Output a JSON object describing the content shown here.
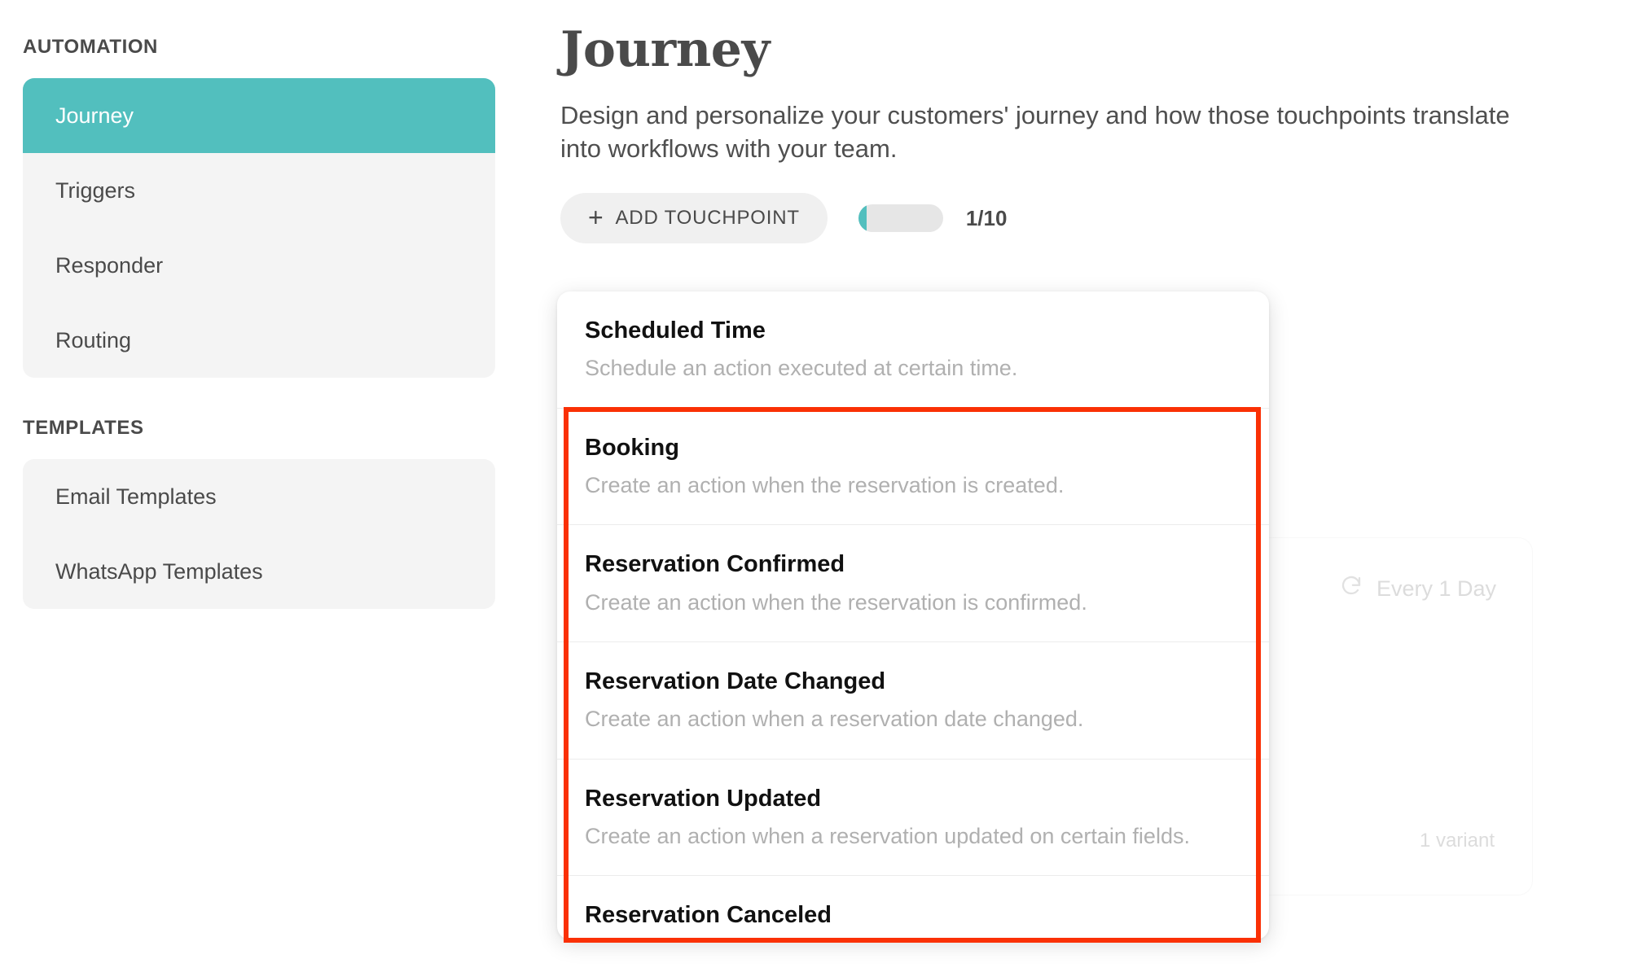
{
  "sidebar": {
    "sections": [
      {
        "label": "AUTOMATION",
        "items": [
          {
            "label": "Journey",
            "active": true
          },
          {
            "label": "Triggers",
            "active": false
          },
          {
            "label": "Responder",
            "active": false
          },
          {
            "label": "Routing",
            "active": false
          }
        ]
      },
      {
        "label": "TEMPLATES",
        "items": [
          {
            "label": "Email Templates",
            "active": false
          },
          {
            "label": "WhatsApp Templates",
            "active": false
          }
        ]
      }
    ]
  },
  "main": {
    "title": "Journey",
    "subtitle": "Design and personalize your customers' journey and how those touchpoints translate into workflows with your team.",
    "toolbar": {
      "add_touchpoint_label": "ADD TOUCHPOINT",
      "add_icon": "plus-icon",
      "progress_count": "1/10",
      "progress_current": 1,
      "progress_total": 10,
      "progress_percent": 10
    }
  },
  "background_card": {
    "schedule_icon": "refresh-icon",
    "schedule_label": "Every 1 Day",
    "variant_label": "1 variant"
  },
  "dropdown": {
    "items": [
      {
        "title": "Scheduled Time",
        "description": "Schedule an action executed at certain time."
      },
      {
        "title": "Booking",
        "description": "Create an action when the reservation is created."
      },
      {
        "title": "Reservation Confirmed",
        "description": "Create an action when the reservation is confirmed."
      },
      {
        "title": "Reservation Date Changed",
        "description": "Create an action when a reservation date changed."
      },
      {
        "title": "Reservation Updated",
        "description": "Create an action when a reservation updated on certain fields."
      },
      {
        "title": "Reservation Canceled",
        "description": ""
      }
    ]
  },
  "annotation": {
    "highlight_color": "#fa3005"
  },
  "colors": {
    "accent_teal": "#52bfbe",
    "sidebar_card": "#f4f4f4",
    "text_primary": "#4a4a4a",
    "text_muted": "#b0b0b0",
    "highlight_red": "#fa3005"
  }
}
